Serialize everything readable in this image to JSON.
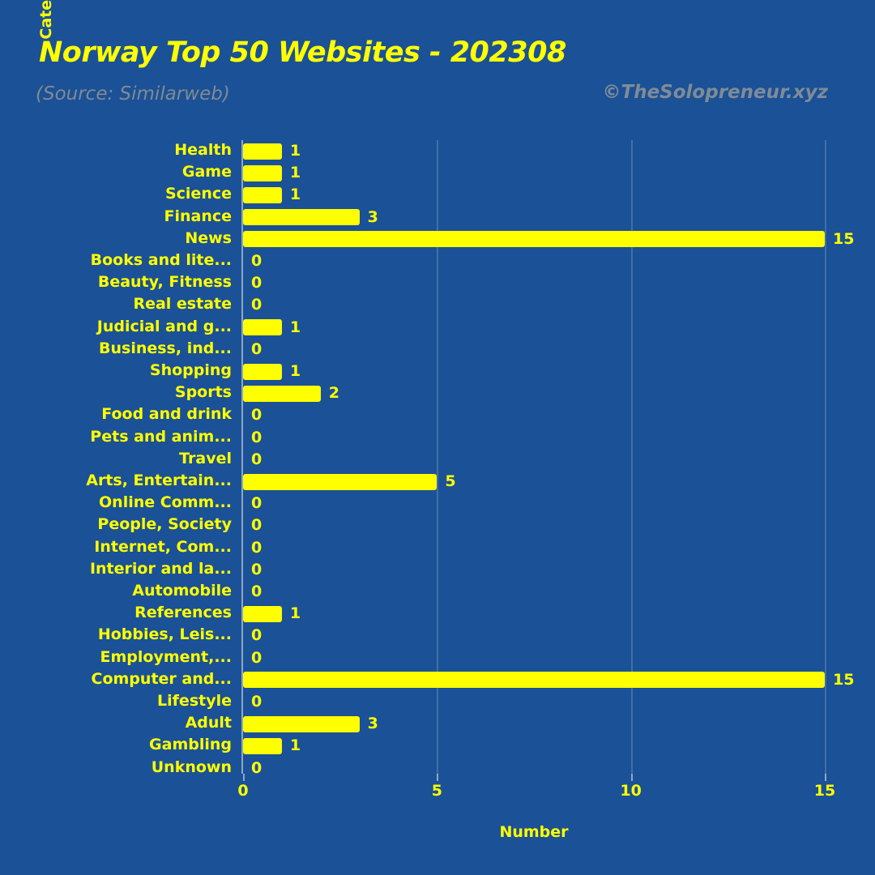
{
  "header": {
    "title": "Norway Top 50 Websites - 202308",
    "subtitle": "(Source: Similarweb)",
    "credit": "©TheSolopreneur.xyz"
  },
  "colors": {
    "background": "#1b5196",
    "bar": "#ffff00",
    "text": "#ffff00",
    "subtitle": "#808a94",
    "grid": "#3f6fab",
    "axis": "#8fa7c4"
  },
  "chart_data": {
    "type": "bar",
    "orientation": "horizontal",
    "title": "Norway Top 50 Websites - 202308",
    "subtitle": "(Source: Similarweb)",
    "xlabel": "Number",
    "ylabel": "Category",
    "xlim": [
      0,
      15
    ],
    "xticks": [
      0,
      5,
      10,
      15
    ],
    "xtick_labels": [
      "0",
      "5",
      "10",
      "15"
    ],
    "grid": true,
    "legend": null,
    "categories": [
      "Health",
      "Game",
      "Science",
      "Finance",
      "News",
      "Books and lite...",
      "Beauty, Fitness",
      "Real estate",
      "Judicial and g...",
      "Business, ind...",
      "Shopping",
      "Sports",
      "Food and drink",
      "Pets and anim...",
      "Travel",
      "Arts, Entertain...",
      "Online Comm...",
      "People, Society",
      "Internet, Com...",
      "Interior and la...",
      "Automobile",
      "References",
      "Hobbies, Leis...",
      "Employment,...",
      "Computer and...",
      "Lifestyle",
      "Adult",
      "Gambling",
      "Unknown"
    ],
    "values": [
      1,
      1,
      1,
      3,
      15,
      0,
      0,
      0,
      1,
      0,
      1,
      2,
      0,
      0,
      0,
      5,
      0,
      0,
      0,
      0,
      0,
      1,
      0,
      0,
      15,
      0,
      3,
      1,
      0
    ],
    "value_labels": [
      "1",
      "1",
      "1",
      "3",
      "15",
      "0",
      "0",
      "0",
      "1",
      "0",
      "1",
      "2",
      "0",
      "0",
      "0",
      "5",
      "0",
      "0",
      "0",
      "0",
      "0",
      "1",
      "0",
      "0",
      "15",
      "0",
      "3",
      "1",
      "0"
    ]
  }
}
